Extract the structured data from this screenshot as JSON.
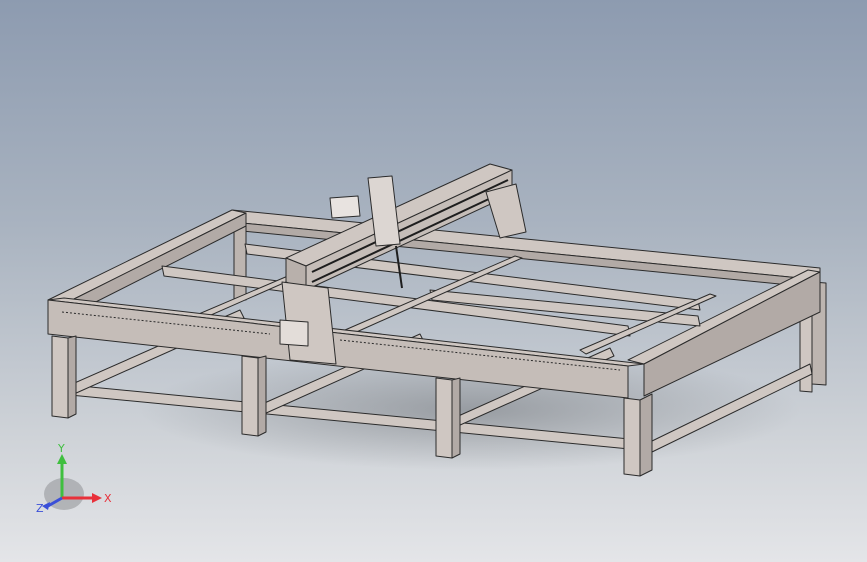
{
  "viewport": {
    "background_top": "#8d9bb0",
    "background_bottom": "#e4e5e8"
  },
  "model": {
    "part_fill": "#cfc7c2",
    "part_shade": "#b2aaa6",
    "edge_color": "#2b2b2b"
  },
  "triad": {
    "x_label": "X",
    "y_label": "Y",
    "z_label": "Z",
    "x_color": "#e8303a",
    "y_color": "#3fbf3f",
    "z_color": "#3a4fd8"
  }
}
